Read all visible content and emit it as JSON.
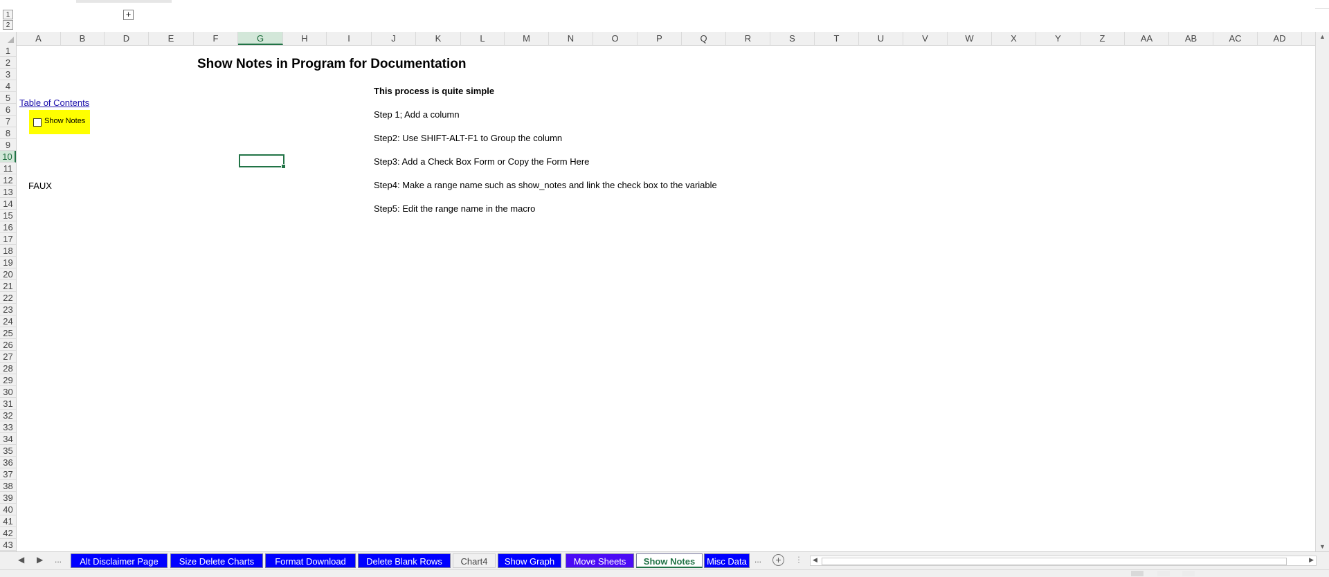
{
  "outline": {
    "levels": [
      "1",
      "2"
    ],
    "expand_symbol": "+"
  },
  "columns": [
    "A",
    "B",
    "D",
    "E",
    "F",
    "G",
    "H",
    "I",
    "J",
    "K",
    "L",
    "M",
    "N",
    "O",
    "P",
    "Q",
    "R",
    "S",
    "T",
    "U",
    "V",
    "W",
    "X",
    "Y",
    "Z",
    "AA",
    "AB",
    "AC",
    "AD"
  ],
  "selected_column": "G",
  "rows": [
    "1",
    "2",
    "3",
    "4",
    "5",
    "6",
    "7",
    "8",
    "9",
    "10",
    "11",
    "12",
    "13",
    "14",
    "15",
    "16",
    "17",
    "18",
    "19",
    "20",
    "21",
    "22",
    "23",
    "24",
    "25",
    "26",
    "27",
    "28",
    "29",
    "30",
    "31",
    "32",
    "33",
    "34",
    "35",
    "36",
    "37",
    "38",
    "39",
    "40",
    "41",
    "42",
    "43"
  ],
  "selected_row": "10",
  "sheet": {
    "title": "Show Notes in Program for Documentation",
    "toc_link": "Table of Contents",
    "checkbox_label": "Show Notes",
    "checkbox_fill": "#ffff00",
    "faux_value": "FAUX",
    "steps": [
      "This process is quite simple",
      "Step 1; Add a column",
      "Step2: Use SHIFT-ALT-F1 to Group the column",
      "Step3: Add a Check Box Form or Copy the Form Here",
      "Step4: Make a range name such as show_notes and link the check box to the variable",
      "Step5: Edit the range name in the macro"
    ]
  },
  "tabs": {
    "nav_more": "...",
    "more_right": "...",
    "items": [
      "Alt Disclaimer Page",
      "Size Delete Charts",
      "Format Download",
      "Delete Blank Rows",
      "Chart4",
      "Show Graph",
      "Move Sheets",
      "Show Notes",
      "Misc Data"
    ],
    "active": "Show Notes",
    "tab_color": "#0000ff",
    "add_symbol": "+"
  },
  "colors": {
    "accent": "#217346",
    "header_bg": "#f0f0f0"
  }
}
